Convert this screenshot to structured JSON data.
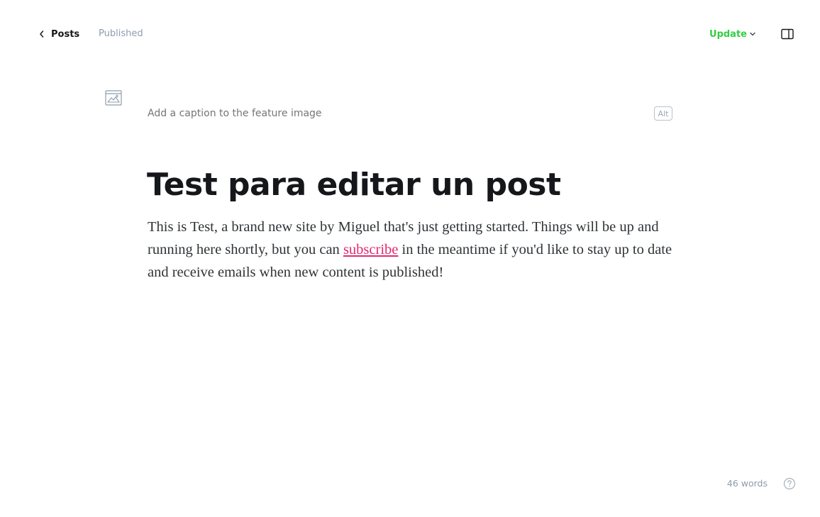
{
  "header": {
    "back_label": "Posts",
    "status": "Published",
    "update_label": "Update"
  },
  "feature_image": {
    "caption_placeholder": "Add a caption to the feature image",
    "alt_label": "Alt"
  },
  "post": {
    "title": "Test para editar un post",
    "body_before_link": "This is Test, a brand new site by Miguel that's just getting started. Things will be up and running here shortly, but you can ",
    "link_text": "subscribe",
    "body_after_link": " in the meantime if you'd like to stay up to date and receive emails when new content is published!"
  },
  "footer": {
    "word_count": "46 words"
  },
  "colors": {
    "accent_green": "#30cf43",
    "link_pink": "#e4286e",
    "muted_text": "#8e9cac",
    "title_text": "#15171a"
  },
  "icons": {
    "back": "chevron-left-icon",
    "update_dropdown": "chevron-down-icon",
    "sidebar": "sidebar-toggle-icon",
    "feature_image": "image-icon",
    "help": "help-circle-icon"
  }
}
